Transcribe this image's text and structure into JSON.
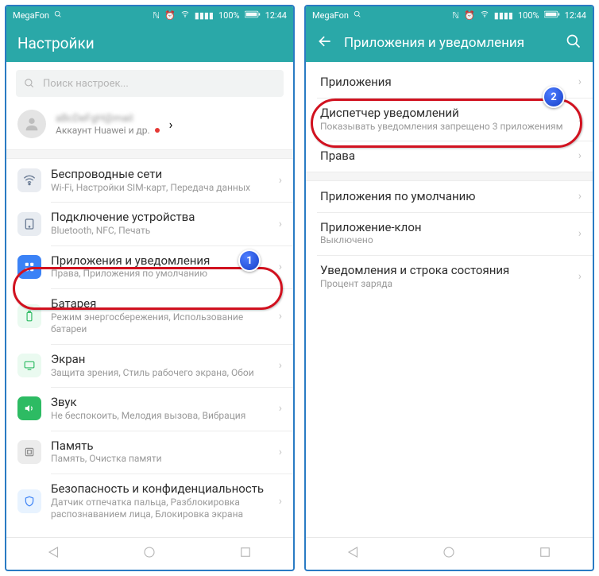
{
  "status": {
    "carrier": "MegaFon",
    "battery": "100%",
    "time": "12:44"
  },
  "left": {
    "title": "Настройки",
    "search_placeholder": "Поиск настроек...",
    "account_sub": "Аккаунт Huawei и др.",
    "account_blur": "aBcDeFgH@mail",
    "items": [
      {
        "label": "Беспроводные сети",
        "sub": "Wi-Fi, Настройки SIM-карт, Передача данных"
      },
      {
        "label": "Подключение устройства",
        "sub": "Bluetooth, NFC, Печать"
      },
      {
        "label": "Приложения и уведомления",
        "sub": "Права, Приложения по умолчанию"
      },
      {
        "label": "Батарея",
        "sub": "Режим энергосбережения, Использование батареи"
      },
      {
        "label": "Экран",
        "sub": "Защита зрения, Стиль рабочего экрана, Обои"
      },
      {
        "label": "Звук",
        "sub": "Не беспокоить, Мелодия вызова, Вибрация"
      },
      {
        "label": "Память",
        "sub": "Память, Очистка памяти"
      },
      {
        "label": "Безопасность и конфиденциальность",
        "sub": "Датчик отпечатка пальца, Разблокировка распознаванием лица, Блокировка экрана"
      }
    ]
  },
  "right": {
    "title": "Приложения и уведомления",
    "items": [
      {
        "label": "Приложения",
        "sub": ""
      },
      {
        "label": "Диспетчер уведомлений",
        "sub": "Показывать уведомления запрещено 3 приложениям"
      },
      {
        "label": "Права",
        "sub": ""
      },
      {
        "label": "Приложения по умолчанию",
        "sub": ""
      },
      {
        "label": "Приложение-клон",
        "sub": "Выключено"
      },
      {
        "label": "Уведомления и строка состояния",
        "sub": "Процент заряда"
      }
    ]
  },
  "callouts": {
    "one": "1",
    "two": "2"
  }
}
